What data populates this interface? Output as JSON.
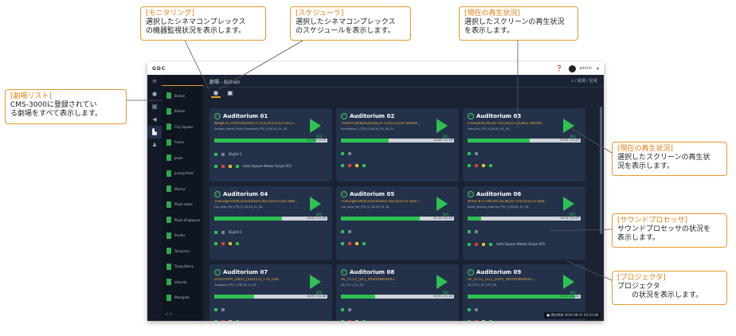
{
  "callouts": {
    "monitoring": {
      "title": "[モニタリング]",
      "text": "選択したシネマコンプレックス\nの機器監視状況を表示します。"
    },
    "scheduler": {
      "title": "[スケジューラ]",
      "text": "選択したシネマコンプレックス\nのスケジュールを表示します。"
    },
    "playback_top": {
      "title": "[現在の再生状況]",
      "text": "選択したスクリーンの再生状況\nを表示します。"
    },
    "theater_list": {
      "title": "[劇場リスト]",
      "text": "CMS-3000に登録されてい\nる劇場をすべて表示します。"
    },
    "playback_right": {
      "title": "[現在の再生状況]",
      "text": "選択したスクリーンの再生状\n況を表示します。"
    },
    "sound_processor": {
      "title": "[サウンドプロセッサ]",
      "text": "サウンドプロセッサの状況を\n表示します。"
    },
    "projector": {
      "title": "[プロジェクタ]",
      "text": "プロジェクタ\n　　の状況を表示します。"
    }
  },
  "app": {
    "logo": "GDC",
    "user_name": "admin",
    "theater_title": "劇場 - Bishan",
    "breadcrumb": "⌂ / 劇場 / 監視",
    "sidebar_items": [
      "Bishan",
      "Bishan",
      "City Square",
      "Funan",
      "Jewel",
      "Jurong Point",
      "Marina",
      "Plaza Lebar",
      "Plaza Singapura",
      "Suntec",
      "Tampines",
      "Tiong Bahru",
      "Velocity",
      "Westgate"
    ],
    "sidebar_footer": "v1.0",
    "status_chip": "■ 現在時刻 2020-08-21 03:33:48",
    "play_label": "再生",
    "cards": [
      {
        "name": "Auditorium 01",
        "content": "NBigFun-TheProtected (FTR)(2D)(51)(2-ID13...",
        "meta": "Jurassic_World_Fallen_Kingdom_FTR_S_EN-XX_51_2K",
        "progress": 0.9,
        "time": "00:28 / 01:56",
        "row_label": "Digital 1",
        "sound_label": "Auto Square Weeks Scope 051"
      },
      {
        "name": "Auditorium 02",
        "content": "TheIncredibles2(ENG)(FTR)(51)(2D)-4bd48...",
        "meta": "Incredibles_2_FTR_S_EN-XX_51_2K_DI",
        "progress": 0.42,
        "time": "00:48 / 01:58",
        "row_label": "",
        "sound_label": ""
      },
      {
        "name": "Auditorium 03",
        "content": "FreeSolo(ENG)(FTR)(2D)(51)(ENG)-4bf5fb...",
        "meta": "FreeSolo_FTR_S_EN-XX_51_2K",
        "progress": 0.55,
        "time": "01:05 / 01:40",
        "row_label": "",
        "sound_label": ""
      },
      {
        "name": "Auditorium 04",
        "content": "TheLegendOfLuoXiaoHei(CN)(2D)(51)(B)-4bb...",
        "meta": "Luo_Xiao_Hei_FTR_S_CN-XX_51_2K",
        "progress": 0.6,
        "time": "00:52 / 01:42",
        "row_label": "Digital 1",
        "sound_label": ""
      },
      {
        "name": "Auditorium 05",
        "content": "TheLegendOfLuoXiaoHei(CN)(2D)(51)-4bd7...",
        "meta": "Luo_Xiao_Hei_FTR_S_CN-XX_51_2K",
        "progress": 0.7,
        "time": "01:10 / 01:42",
        "row_label": "",
        "sound_label": ""
      },
      {
        "name": "Auditorium 06",
        "content": "WRECK-IT-RALPH-2(ENG)(FTR)(2D)(51)-4bb...",
        "meta": "Ralph_Breaks_Internet_FTR_S_EN-XX_51_2K",
        "progress": 0.12,
        "time": "00:14 / 01:52",
        "row_label": "",
        "sound_label": "Auto Square Weeks Scope 051"
      },
      {
        "name": "Auditorium 07",
        "content": "ZOOTOPIA_(DLV)_(2D)(51)_FTR_(EN...",
        "meta": "Zootopia_FTR_S_EN-XX_51_2K",
        "progress": 0.35,
        "time": "00:37 / 01:48",
        "row_label": "",
        "sound_label": ""
      },
      {
        "name": "Auditorium 08",
        "content": "VE_0711_(SC)_XROYAMA0A01...",
        "meta": "VE_0711_SC_2K",
        "progress": 0.3,
        "time": "00:30 / 01:40",
        "row_label": "",
        "sound_label": ""
      },
      {
        "name": "Auditorium 09",
        "content": "VE_0711_(SC)_(5YP)_XROYAMA0A01...",
        "meta": "VE_0711_SC_5YP_2K",
        "progress": 0.95,
        "time": "01:35 / 01:40",
        "row_label": "",
        "sound_label": ""
      }
    ]
  },
  "colors": {
    "accent": "#e39a2c",
    "play_green": "#2fc152",
    "content_orange": "#f0a640",
    "app_bg": "#1a2233"
  }
}
